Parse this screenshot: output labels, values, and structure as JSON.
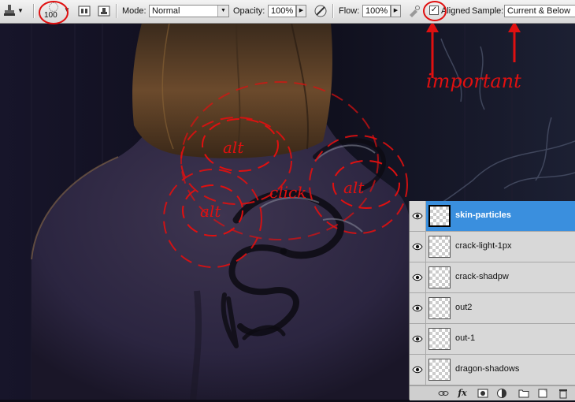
{
  "toolbar": {
    "brush_size": "100",
    "mode_label": "Mode:",
    "mode_value": "Normal",
    "opacity_label": "Opacity:",
    "opacity_value": "100%",
    "flow_label": "Flow:",
    "flow_value": "100%",
    "aligned_label": "Aligned",
    "aligned_checked": true,
    "sample_label": "Sample:",
    "sample_value": "Current & Below",
    "icons": [
      "clone-stamp-icon",
      "tool-preset-arrow-icon",
      "brush-preset-icon",
      "clone-source-panel-icon",
      "sample-layers-icon",
      "tablet-pressure-opacity-icon",
      "airbrush-icon"
    ]
  },
  "annotations": {
    "alt_1": "alt",
    "alt_2": "alt",
    "alt_3": "alt",
    "click": "click",
    "important": "important",
    "color": "#e01010"
  },
  "layers_panel": {
    "layers": [
      {
        "name": "skin-particles",
        "selected": true,
        "visible": true
      },
      {
        "name": "crack-light-1px",
        "selected": false,
        "visible": true
      },
      {
        "name": "crack-shadpw",
        "selected": false,
        "visible": true
      },
      {
        "name": "out2",
        "selected": false,
        "visible": true
      },
      {
        "name": "out-1",
        "selected": false,
        "visible": true
      },
      {
        "name": "dragon-shadows",
        "selected": false,
        "visible": true
      }
    ],
    "footer_icons": [
      "link-layers-icon",
      "fx-icon",
      "layer-mask-icon",
      "adjustment-layer-icon",
      "new-group-icon",
      "new-layer-icon",
      "trash-icon"
    ],
    "fx_label": "fx"
  },
  "colors": {
    "selected_layer": "#3a8fde",
    "annotation": "#e01010"
  }
}
